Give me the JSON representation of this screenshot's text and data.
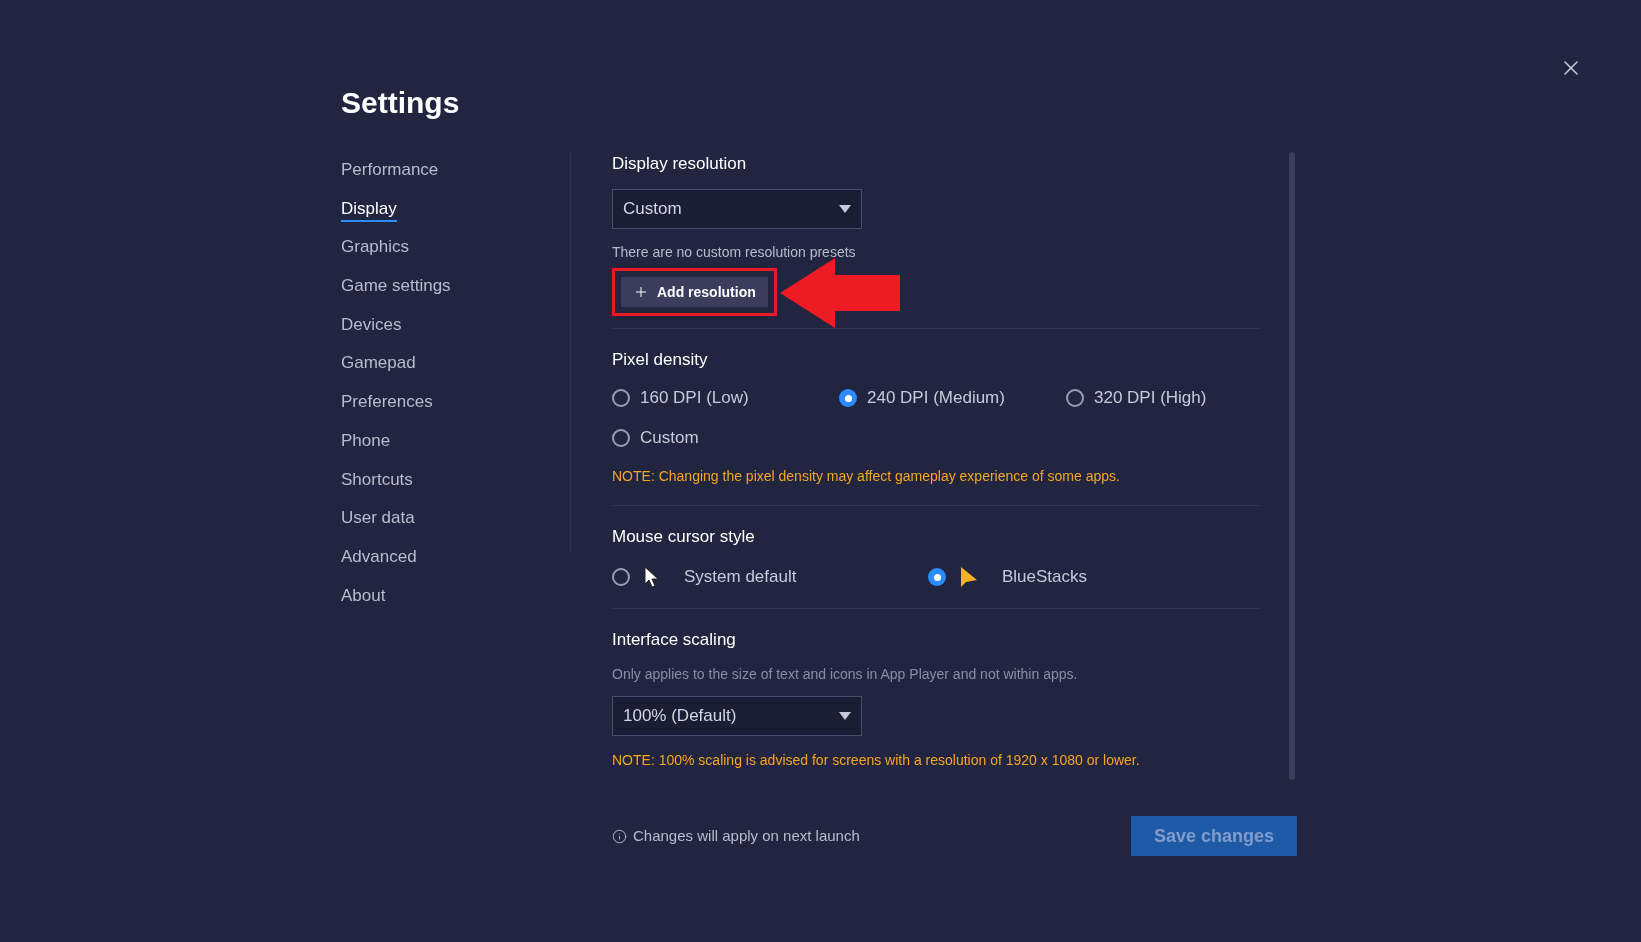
{
  "title": "Settings",
  "nav": [
    {
      "label": "Performance",
      "selected": false
    },
    {
      "label": "Display",
      "selected": true
    },
    {
      "label": "Graphics",
      "selected": false
    },
    {
      "label": "Game settings",
      "selected": false
    },
    {
      "label": "Devices",
      "selected": false
    },
    {
      "label": "Gamepad",
      "selected": false
    },
    {
      "label": "Preferences",
      "selected": false
    },
    {
      "label": "Phone",
      "selected": false
    },
    {
      "label": "Shortcuts",
      "selected": false
    },
    {
      "label": "User data",
      "selected": false
    },
    {
      "label": "Advanced",
      "selected": false
    },
    {
      "label": "About",
      "selected": false
    }
  ],
  "display_resolution": {
    "heading": "Display resolution",
    "dropdown": "Custom",
    "empty_text": "There are no custom resolution presets",
    "add_button": "Add resolution"
  },
  "pixel_density": {
    "heading": "Pixel density",
    "options": [
      {
        "label": "160 DPI (Low)",
        "selected": false
      },
      {
        "label": "240 DPI (Medium)",
        "selected": true
      },
      {
        "label": "320 DPI (High)",
        "selected": false
      },
      {
        "label": "Custom",
        "selected": false
      }
    ],
    "note": "NOTE: Changing the pixel density may affect gameplay experience of some apps."
  },
  "mouse_cursor": {
    "heading": "Mouse cursor style",
    "options": [
      {
        "label": "System default",
        "selected": false,
        "kind": "system"
      },
      {
        "label": "BlueStacks",
        "selected": true,
        "kind": "bluestacks"
      }
    ]
  },
  "interface_scaling": {
    "heading": "Interface scaling",
    "description": "Only applies to the size of text and icons in App Player and not within apps.",
    "dropdown": "100% (Default)",
    "note": "NOTE: 100% scaling is advised for screens with a resolution of 1920 x 1080 or lower."
  },
  "footer": {
    "info": "Changes will apply on next launch",
    "save_button": "Save changes",
    "save_disabled": true
  }
}
